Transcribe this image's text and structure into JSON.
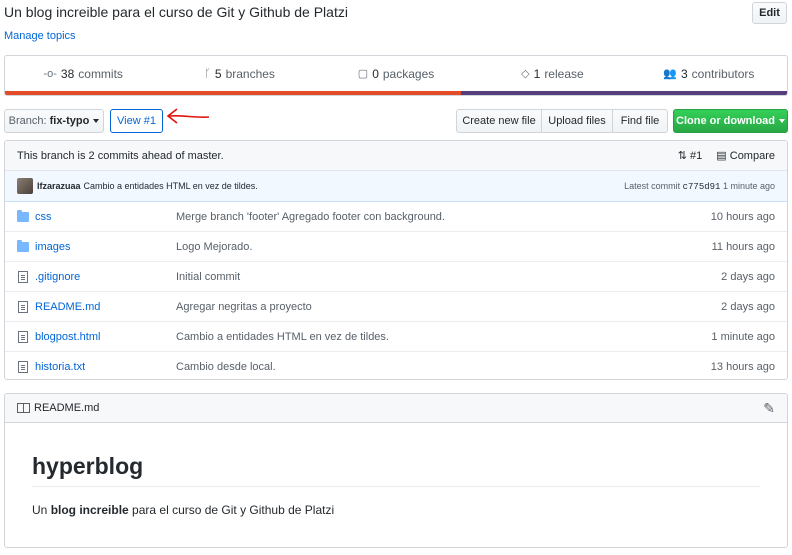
{
  "repo": {
    "description": "Un blog increible para el curso de Git y Github de Platzi",
    "manage_topics": "Manage topics",
    "edit_label": "Edit"
  },
  "summary": {
    "commits": {
      "count": "38",
      "label": "commits",
      "icon": "commit-icon"
    },
    "branches": {
      "count": "5",
      "label": "branches",
      "icon": "branch-icon"
    },
    "packages": {
      "count": "0",
      "label": "packages",
      "icon": "package-icon"
    },
    "releases": {
      "count": "1",
      "label": "release",
      "icon": "tag-icon"
    },
    "contributors": {
      "count": "3",
      "label": "contributors",
      "icon": "people-icon"
    },
    "language_colors": [
      "#e34c26",
      "#563d7c"
    ]
  },
  "toolbar": {
    "branch_label": "Branch:",
    "branch_value": "fix-typo",
    "view_pr": "View #1",
    "create_file": "Create new file",
    "upload_files": "Upload files",
    "find_file": "Find file",
    "clone": "Clone or download"
  },
  "branch_info": {
    "ahead_text": "This branch is 2 commits ahead of master.",
    "pr_label": "#1",
    "compare_label": "Compare"
  },
  "latest_commit": {
    "author": "lfzarazuaa",
    "message": "Cambio a entidades HTML en vez de tildes.",
    "prefix": "Latest commit",
    "sha": "c775d91",
    "time": "1 minute ago"
  },
  "files": [
    {
      "type": "dir",
      "name": "css",
      "message": "Merge branch 'footer' Agregado footer con background.",
      "age": "10 hours ago"
    },
    {
      "type": "dir",
      "name": "images",
      "message": "Logo Mejorado.",
      "age": "11 hours ago"
    },
    {
      "type": "file",
      "name": ".gitignore",
      "message": "Initial commit",
      "age": "2 days ago"
    },
    {
      "type": "file",
      "name": "README.md",
      "message": "Agregar negritas a proyecto",
      "age": "2 days ago"
    },
    {
      "type": "file",
      "name": "blogpost.html",
      "message": "Cambio a entidades HTML en vez de tildes.",
      "age": "1 minute ago"
    },
    {
      "type": "file",
      "name": "historia.txt",
      "message": "Cambio desde local.",
      "age": "13 hours ago"
    }
  ],
  "readme": {
    "filename": "README.md",
    "title": "hyperblog",
    "text_prefix": "Un ",
    "text_bold": "blog increible",
    "text_suffix": " para el curso de Git y Github de Platzi"
  }
}
